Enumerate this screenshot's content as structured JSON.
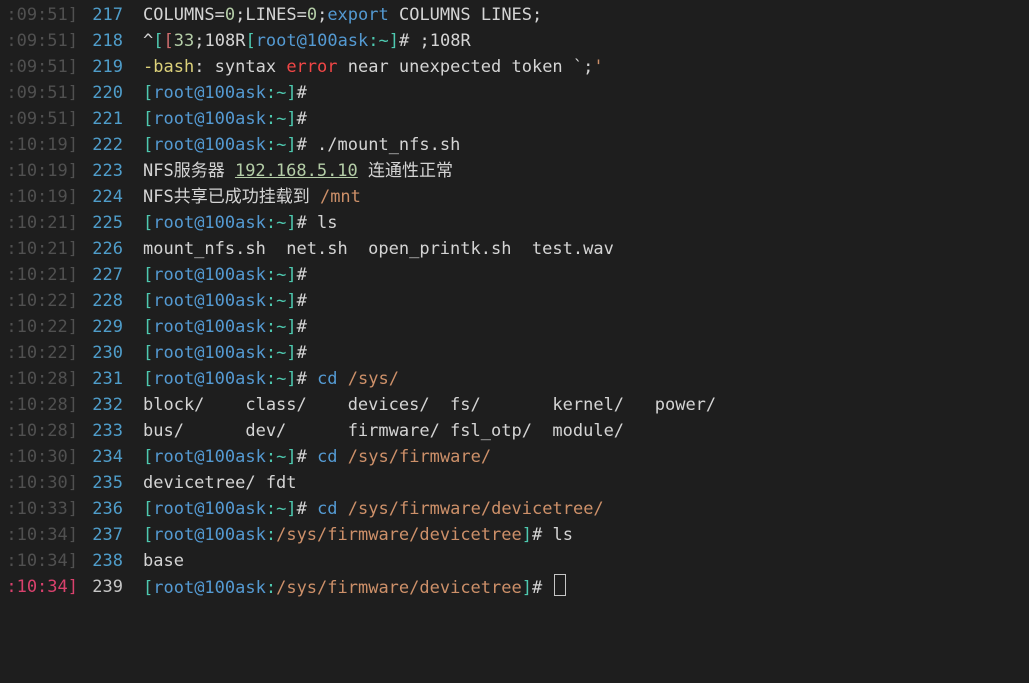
{
  "lines": [
    {
      "ts": ":09:51]",
      "no": "217",
      "segs": [
        {
          "t": "COLUMNS",
          "c": "c-dflt"
        },
        {
          "t": "=",
          "c": "c-dflt"
        },
        {
          "t": "0",
          "c": "c-num"
        },
        {
          "t": ";LINES=",
          "c": "c-dflt"
        },
        {
          "t": "0",
          "c": "c-num"
        },
        {
          "t": ";",
          "c": "c-dflt"
        },
        {
          "t": "export",
          "c": "c-kw"
        },
        {
          "t": " COLUMNS LINES;",
          "c": "c-dflt"
        }
      ]
    },
    {
      "ts": ":09:51]",
      "no": "218",
      "segs": [
        {
          "t": "^",
          "c": "c-dflt"
        },
        {
          "t": "[",
          "c": "c-prmt"
        },
        {
          "t": "[",
          "c": "brkerr"
        },
        {
          "t": "33",
          "c": "c-num"
        },
        {
          "t": ";",
          "c": "c-dflt"
        },
        {
          "t": "108R",
          "c": "c-dflt"
        },
        {
          "t": "[",
          "c": "c-prmt"
        },
        {
          "t": "root@100ask",
          "c": "c-usr"
        },
        {
          "t": ":~",
          "c": "c-prmt"
        },
        {
          "t": "]",
          "c": "c-prmt"
        },
        {
          "t": "# ;",
          "c": "c-dflt"
        },
        {
          "t": "108R",
          "c": "c-dflt"
        }
      ]
    },
    {
      "ts": ":09:51]",
      "no": "219",
      "segs": [
        {
          "t": "-bash",
          "c": "c-yl"
        },
        {
          "t": ": syntax ",
          "c": "c-dflt"
        },
        {
          "t": "error",
          "c": "c-err"
        },
        {
          "t": " near unexpected token `;",
          "c": "c-dflt"
        },
        {
          "t": "'",
          "c": "c-path"
        }
      ]
    },
    {
      "ts": ":09:51]",
      "no": "220",
      "segs": [
        {
          "t": "[",
          "c": "c-prmt"
        },
        {
          "t": "root@100ask",
          "c": "c-usr"
        },
        {
          "t": ":~",
          "c": "c-prmt"
        },
        {
          "t": "]",
          "c": "c-prmt"
        },
        {
          "t": "# ",
          "c": "c-dflt"
        }
      ]
    },
    {
      "ts": ":09:51]",
      "no": "221",
      "segs": [
        {
          "t": "[",
          "c": "c-prmt"
        },
        {
          "t": "root@100ask",
          "c": "c-usr"
        },
        {
          "t": ":~",
          "c": "c-prmt"
        },
        {
          "t": "]",
          "c": "c-prmt"
        },
        {
          "t": "# ",
          "c": "c-dflt"
        }
      ]
    },
    {
      "ts": ":10:19]",
      "no": "222",
      "segs": [
        {
          "t": "[",
          "c": "c-prmt"
        },
        {
          "t": "root@100ask",
          "c": "c-usr"
        },
        {
          "t": ":~",
          "c": "c-prmt"
        },
        {
          "t": "]",
          "c": "c-prmt"
        },
        {
          "t": "# ./mount_nfs.sh",
          "c": "c-dflt"
        }
      ]
    },
    {
      "ts": ":10:19]",
      "no": "223",
      "segs": [
        {
          "t": "NFS服务器 ",
          "c": "c-dflt"
        },
        {
          "t": "192.168.5.10",
          "c": "c-ip"
        },
        {
          "t": " 连通性正常",
          "c": "c-dflt"
        }
      ]
    },
    {
      "ts": ":10:19]",
      "no": "224",
      "segs": [
        {
          "t": "NFS共享已成功挂载到 ",
          "c": "c-dflt"
        },
        {
          "t": "/mnt",
          "c": "c-path"
        }
      ]
    },
    {
      "ts": ":10:21]",
      "no": "225",
      "segs": [
        {
          "t": "[",
          "c": "c-prmt"
        },
        {
          "t": "root@100ask",
          "c": "c-usr"
        },
        {
          "t": ":~",
          "c": "c-prmt"
        },
        {
          "t": "]",
          "c": "c-prmt"
        },
        {
          "t": "# ls",
          "c": "c-dflt"
        }
      ]
    },
    {
      "ts": ":10:21]",
      "no": "226",
      "segs": [
        {
          "t": "mount_nfs.sh  net.sh  open_printk.sh  test.wav",
          "c": "c-dflt"
        }
      ]
    },
    {
      "ts": ":10:21]",
      "no": "227",
      "segs": [
        {
          "t": "[",
          "c": "c-prmt"
        },
        {
          "t": "root@100ask",
          "c": "c-usr"
        },
        {
          "t": ":~",
          "c": "c-prmt"
        },
        {
          "t": "]",
          "c": "c-prmt"
        },
        {
          "t": "# ",
          "c": "c-dflt"
        }
      ]
    },
    {
      "ts": ":10:22]",
      "no": "228",
      "segs": [
        {
          "t": "[",
          "c": "c-prmt"
        },
        {
          "t": "root@100ask",
          "c": "c-usr"
        },
        {
          "t": ":~",
          "c": "c-prmt"
        },
        {
          "t": "]",
          "c": "c-prmt"
        },
        {
          "t": "# ",
          "c": "c-dflt"
        }
      ]
    },
    {
      "ts": ":10:22]",
      "no": "229",
      "segs": [
        {
          "t": "[",
          "c": "c-prmt"
        },
        {
          "t": "root@100ask",
          "c": "c-usr"
        },
        {
          "t": ":~",
          "c": "c-prmt"
        },
        {
          "t": "]",
          "c": "c-prmt"
        },
        {
          "t": "# ",
          "c": "c-dflt"
        }
      ]
    },
    {
      "ts": ":10:22]",
      "no": "230",
      "segs": [
        {
          "t": "[",
          "c": "c-prmt"
        },
        {
          "t": "root@100ask",
          "c": "c-usr"
        },
        {
          "t": ":~",
          "c": "c-prmt"
        },
        {
          "t": "]",
          "c": "c-prmt"
        },
        {
          "t": "# ",
          "c": "c-dflt"
        }
      ]
    },
    {
      "ts": ":10:28]",
      "no": "231",
      "segs": [
        {
          "t": "[",
          "c": "c-prmt"
        },
        {
          "t": "root@100ask",
          "c": "c-usr"
        },
        {
          "t": ":~",
          "c": "c-prmt"
        },
        {
          "t": "]",
          "c": "c-prmt"
        },
        {
          "t": "# ",
          "c": "c-dflt"
        },
        {
          "t": "cd",
          "c": "c-kw"
        },
        {
          "t": " ",
          "c": "c-dflt"
        },
        {
          "t": "/sys/",
          "c": "c-path"
        }
      ]
    },
    {
      "ts": ":10:28]",
      "no": "232",
      "segs": [
        {
          "t": "block/    class/    devices/  fs/       kernel/   power/",
          "c": "c-dflt"
        }
      ]
    },
    {
      "ts": ":10:28]",
      "no": "233",
      "segs": [
        {
          "t": "bus/      dev/      firmware/ fsl_otp/  module/",
          "c": "c-dflt"
        }
      ]
    },
    {
      "ts": ":10:30]",
      "no": "234",
      "segs": [
        {
          "t": "[",
          "c": "c-prmt"
        },
        {
          "t": "root@100ask",
          "c": "c-usr"
        },
        {
          "t": ":~",
          "c": "c-prmt"
        },
        {
          "t": "]",
          "c": "c-prmt"
        },
        {
          "t": "# ",
          "c": "c-dflt"
        },
        {
          "t": "cd",
          "c": "c-kw"
        },
        {
          "t": " ",
          "c": "c-dflt"
        },
        {
          "t": "/sys/firmware/",
          "c": "c-path"
        }
      ]
    },
    {
      "ts": ":10:30]",
      "no": "235",
      "segs": [
        {
          "t": "devicetree/ fdt",
          "c": "c-dflt"
        }
      ]
    },
    {
      "ts": ":10:33]",
      "no": "236",
      "segs": [
        {
          "t": "[",
          "c": "c-prmt"
        },
        {
          "t": "root@100ask",
          "c": "c-usr"
        },
        {
          "t": ":~",
          "c": "c-prmt"
        },
        {
          "t": "]",
          "c": "c-prmt"
        },
        {
          "t": "# ",
          "c": "c-dflt"
        },
        {
          "t": "cd",
          "c": "c-kw"
        },
        {
          "t": " ",
          "c": "c-dflt"
        },
        {
          "t": "/sys/firmware/devicetree/",
          "c": "c-path"
        }
      ]
    },
    {
      "ts": ":10:34]",
      "no": "237",
      "segs": [
        {
          "t": "[",
          "c": "c-prmt"
        },
        {
          "t": "root@100ask",
          "c": "c-usr"
        },
        {
          "t": ":",
          "c": "c-prmt"
        },
        {
          "t": "/sys/firmware/devicetree",
          "c": "c-path"
        },
        {
          "t": "]",
          "c": "c-prmt"
        },
        {
          "t": "# ls",
          "c": "c-dflt"
        }
      ]
    },
    {
      "ts": ":10:34]",
      "no": "238",
      "segs": [
        {
          "t": "base",
          "c": "c-dflt"
        }
      ]
    },
    {
      "ts": ":10:34]",
      "no": "239",
      "active": true,
      "segs": [
        {
          "t": "[",
          "c": "c-prmt"
        },
        {
          "t": "root@100ask",
          "c": "c-usr"
        },
        {
          "t": ":",
          "c": "c-prmt"
        },
        {
          "t": "/sys/firmware/devicetree",
          "c": "c-path"
        },
        {
          "t": "]",
          "c": "c-prmt"
        },
        {
          "t": "# ",
          "c": "c-dflt"
        },
        {
          "cursor": true
        }
      ]
    }
  ]
}
